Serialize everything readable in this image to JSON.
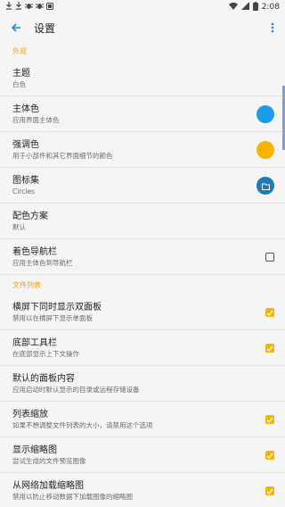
{
  "status": {
    "time": "2:08"
  },
  "header": {
    "title": "设置"
  },
  "sections": [
    {
      "title": "外观",
      "items": [
        {
          "title": "主题",
          "subtitle": "白色"
        },
        {
          "title": "主体色",
          "subtitle": "应用界面主体色",
          "control": "color",
          "color": "#1e9be6"
        },
        {
          "title": "强调色",
          "subtitle": "用于小部件和其它界面细节的颜色",
          "control": "color",
          "color": "#f5b400"
        },
        {
          "title": "图标集",
          "subtitle": "Circles",
          "control": "icon-set",
          "color": "#1c7bb8",
          "icon": "folder-icon"
        },
        {
          "title": "配色方案",
          "subtitle": "默认"
        },
        {
          "title": "着色导航栏",
          "subtitle": "应用主体色到导航栏",
          "control": "checkbox",
          "checked": false
        }
      ]
    },
    {
      "title": "文件列表",
      "items": [
        {
          "title": "横屏下同时显示双面板",
          "subtitle": "禁用以在横屏下显示单面板",
          "control": "checkbox",
          "checked": true
        },
        {
          "title": "底部工具栏",
          "subtitle": "在底部显示上下文操作",
          "control": "checkbox",
          "checked": true
        },
        {
          "title": "默认的面板内容",
          "subtitle": "应用启动时默认显示的目录或远程存储设备"
        },
        {
          "title": "列表缩放",
          "subtitle": "如果不想调整文件列表的大小，请禁用这个选项",
          "control": "checkbox",
          "checked": true
        },
        {
          "title": "显示缩略图",
          "subtitle": "尝试生成的文件预览图像",
          "control": "checkbox",
          "checked": true
        },
        {
          "title": "从网络加载缩略图",
          "subtitle": "禁用以防止移动数据下加载图像的缩略图",
          "control": "checkbox",
          "checked": true
        }
      ]
    }
  ]
}
